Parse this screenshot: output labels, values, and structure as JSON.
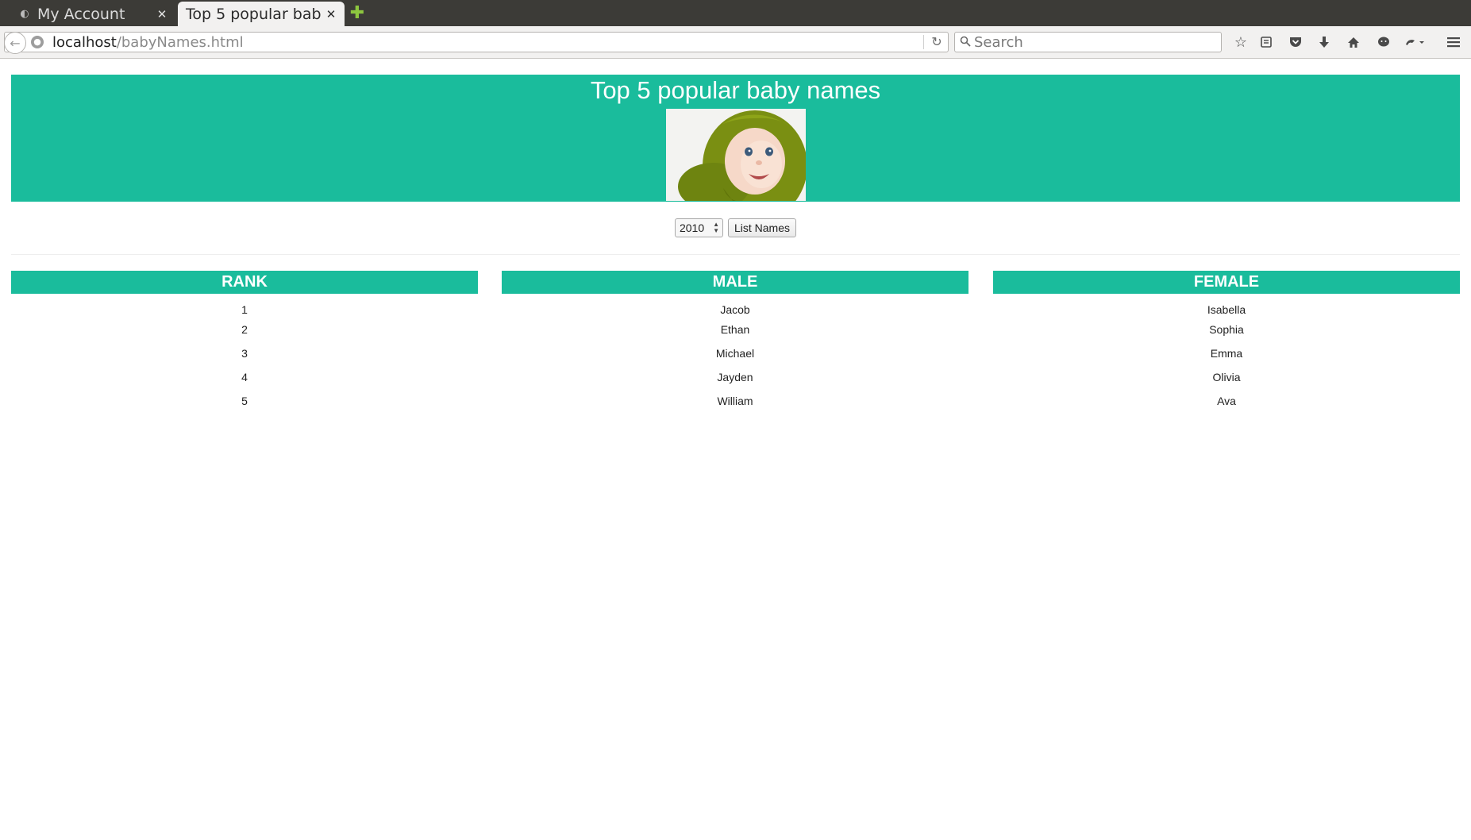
{
  "browser": {
    "tabs": [
      {
        "title": "My Account",
        "active": false
      },
      {
        "title": "Top 5 popular bab…",
        "active": true
      }
    ],
    "url_host": "localhost",
    "url_path": "/babyNames.html",
    "search_placeholder": "Search"
  },
  "page": {
    "title": "Top 5 popular baby names",
    "accent_color": "#1abc9c",
    "year_select": {
      "value": "2010"
    },
    "list_button_label": "List Names",
    "columns": {
      "rank": {
        "header": "RANK",
        "values": [
          "1",
          "2",
          "3",
          "4",
          "5"
        ]
      },
      "male": {
        "header": "MALE",
        "values": [
          "Jacob",
          "Ethan",
          "Michael",
          "Jayden",
          "William"
        ]
      },
      "female": {
        "header": "FEMALE",
        "values": [
          "Isabella",
          "Sophia",
          "Emma",
          "Olivia",
          "Ava"
        ]
      }
    }
  }
}
